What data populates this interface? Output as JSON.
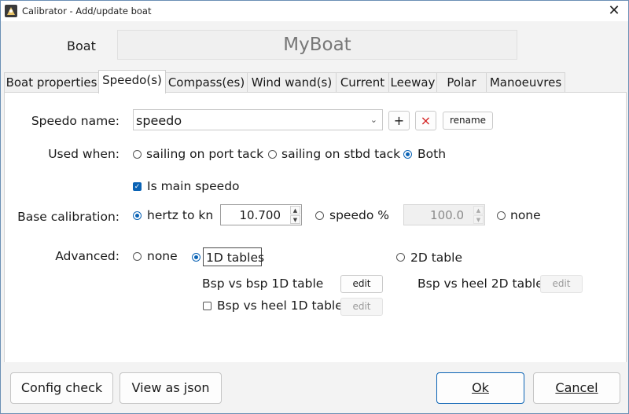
{
  "window": {
    "title": "Calibrator - Add/update boat",
    "icon": "app-icon",
    "close": "✕"
  },
  "boat": {
    "label": "Boat",
    "name": "MyBoat"
  },
  "tabs": [
    "Boat properties",
    "Speedo(s)",
    "Compass(es)",
    "Wind wand(s)",
    "Current",
    "Leeway",
    "Polar",
    "Manoeuvres"
  ],
  "active_tab": "Speedo(s)",
  "speedo": {
    "name_label": "Speedo name:",
    "name_value": "speedo",
    "add": "+",
    "remove": "×",
    "rename": "rename"
  },
  "used_when": {
    "label": "Used when:",
    "options": [
      "sailing on port tack",
      "sailing on stbd tack",
      "Both"
    ],
    "selected": "Both"
  },
  "main_speedo": {
    "label": "Is main speedo",
    "checked": true
  },
  "base_calibration": {
    "label": "Base calibration:",
    "hertz_label": "hertz to kn",
    "hertz_value": "10.700",
    "speedo_pct_label": "speedo %",
    "speedo_pct_value": "100.0",
    "none_label": "none",
    "selected": "hertz to kn"
  },
  "advanced": {
    "label": "Advanced:",
    "none_label": "none",
    "tables1d_label": "1D tables",
    "table2d_label": "2D table",
    "selected": "1D tables",
    "bsp_bsp_1d": "Bsp vs bsp 1D table",
    "bsp_heel_1d": "Bsp vs heel 1D table",
    "bsp_heel_1d_checked": false,
    "bsp_heel_2d": "Bsp vs heel 2D table",
    "edit": "edit"
  },
  "footer": {
    "config_check": "Config check",
    "view_json": "View as json",
    "ok": "Ok",
    "cancel": "Cancel"
  },
  "colors": {
    "accent": "#0a63b5",
    "border": "#6b8fb5"
  }
}
